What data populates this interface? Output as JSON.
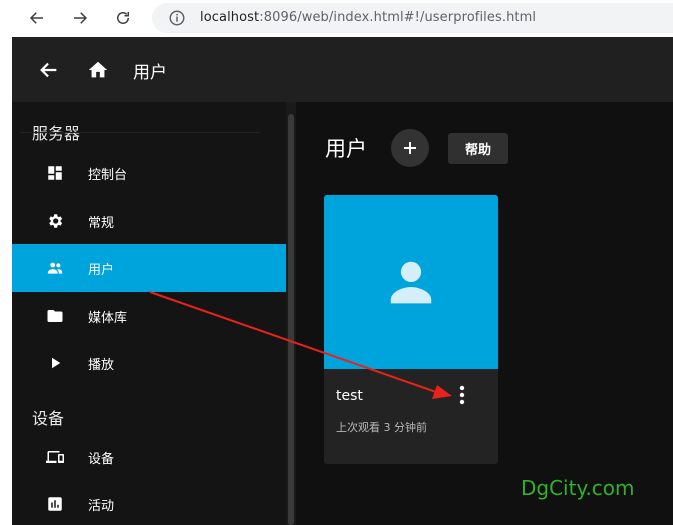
{
  "browser": {
    "url_host": "localhost",
    "url_path": ":8096/web/index.html#!/userprofiles.html"
  },
  "header": {
    "title": "用户"
  },
  "sidebar": {
    "section_server": "服务器",
    "section_devices": "设备",
    "items": [
      {
        "label": "控制台",
        "icon": "dashboard-icon"
      },
      {
        "label": "常规",
        "icon": "gear-icon"
      },
      {
        "label": "用户",
        "icon": "people-icon",
        "active": true
      },
      {
        "label": "媒体库",
        "icon": "folder-icon"
      },
      {
        "label": "播放",
        "icon": "play-icon"
      },
      {
        "label": "设备",
        "icon": "devices-icon"
      },
      {
        "label": "活动",
        "icon": "chart-icon"
      }
    ]
  },
  "main": {
    "title": "用户",
    "add_label": "+",
    "help_label": "帮助",
    "user_card": {
      "name": "test",
      "last_seen": "上次观看 3 分钟前"
    }
  },
  "watermark": "DgCity.com",
  "colors": {
    "accent": "#00a4dc",
    "annotation_arrow": "#e8231c",
    "watermark": "#2fb12a"
  }
}
